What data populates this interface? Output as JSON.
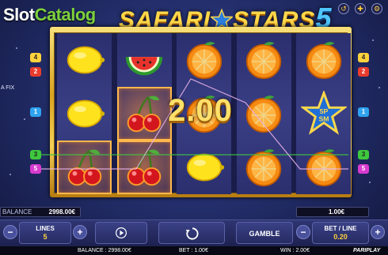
{
  "header": {
    "logo_part1": "Slot",
    "logo_part2": "Catalog",
    "title_part1": "SAFARI",
    "title_part2": "STARS",
    "title_number": "5",
    "provider_tag": "A FIX"
  },
  "reels": {
    "columns": [
      [
        "lemon",
        "lemon",
        "cherry"
      ],
      [
        "watermelon",
        "cherry",
        "cherry"
      ],
      [
        "orange",
        "orange",
        "lemon"
      ],
      [
        "orange",
        "orange",
        "orange"
      ],
      [
        "orange",
        "star",
        "orange"
      ]
    ],
    "winning_cells": [
      [
        0,
        2
      ],
      [
        1,
        1
      ],
      [
        1,
        2
      ]
    ],
    "star_text": "5P\nSM",
    "win_amount": "2.00"
  },
  "paylines": {
    "left_badges": [
      "4",
      "2",
      "1",
      "3",
      "5"
    ],
    "right_badges": [
      "4",
      "2",
      "1",
      "3",
      "5"
    ],
    "colors": {
      "1": "#2fa3f0",
      "2": "#e93c2e",
      "3": "#3ec83e",
      "4": "#ffd23d",
      "5": "#d83ad0"
    }
  },
  "info": {
    "balance_label": "BALANCE",
    "balance_value": "2998.00€",
    "bet_value": "1.00€"
  },
  "controls": {
    "lines_label": "LINES",
    "lines_value": "5",
    "minus": "−",
    "plus": "+",
    "gamble_label": "GAMBLE",
    "bet_line_label": "BET / LINE",
    "bet_line_value": "0.20"
  },
  "status": {
    "balance": "BALANCE : 2998.00€",
    "bet": "BET : 1.00€",
    "win": "WIN : 2.00€",
    "brand": "PARIPLAY"
  }
}
